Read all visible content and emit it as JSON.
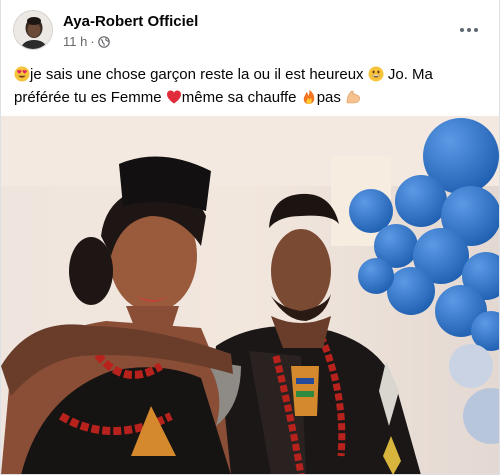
{
  "post": {
    "author": "Aya-Robert Officiel",
    "time": "11 h",
    "separator": "·",
    "audience_icon": "globe-icon",
    "more_icon": "more-options-icon",
    "text_segments": [
      "je sais une chose garçon reste la ou il est heureux",
      "Jo. Ma préférée tu es Femme",
      "même sa chauffe",
      "pas"
    ],
    "emojis": [
      "heart-eyes-emoji",
      "grinning-emoji",
      "red-heart-emoji",
      "fire-emoji",
      "flexed-biceps-emoji"
    ]
  },
  "colors": {
    "text_primary": "#050505",
    "text_secondary": "#65676b",
    "card_border": "#dde1e6",
    "balloon_blue": "#2f74c9"
  }
}
